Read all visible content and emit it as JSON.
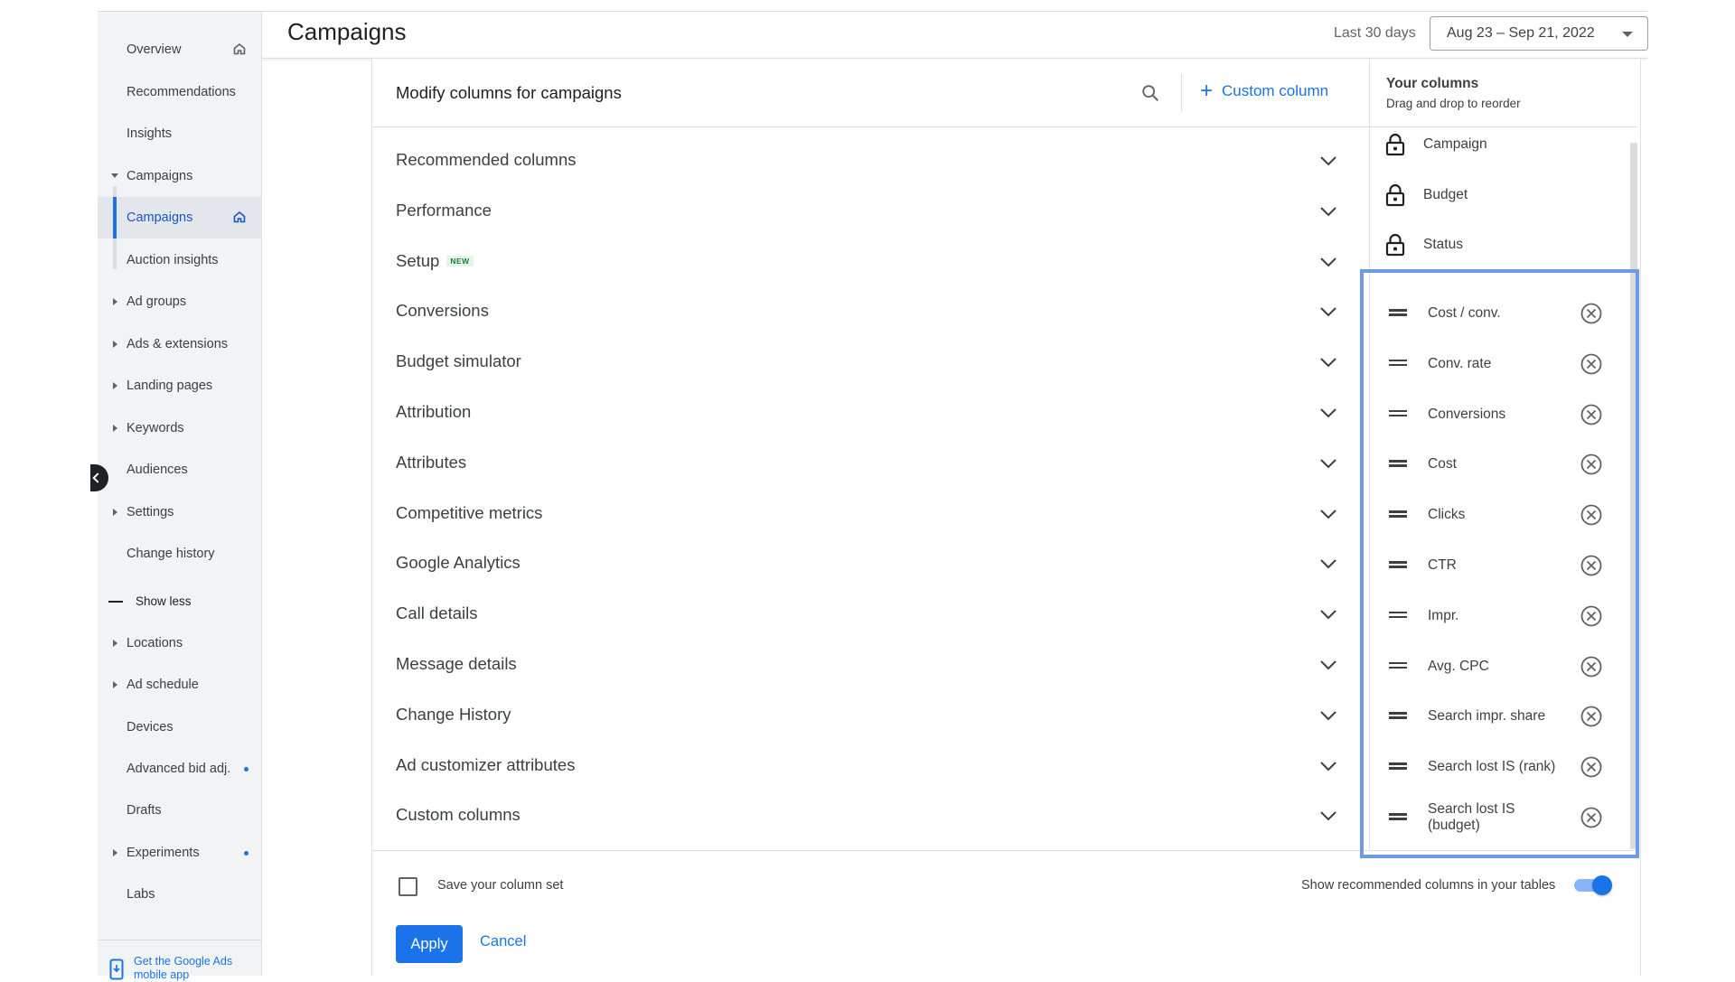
{
  "sidebar": {
    "items": [
      {
        "label": "Overview",
        "arrow": "none",
        "home": true,
        "dot": false
      },
      {
        "label": "Recommendations",
        "arrow": "none",
        "home": false,
        "dot": false
      },
      {
        "label": "Insights",
        "arrow": "none",
        "home": false,
        "dot": false
      },
      {
        "label": "Campaigns",
        "arrow": "down",
        "home": false,
        "dot": false
      },
      {
        "label": "Campaigns",
        "arrow": "none",
        "home": true,
        "dot": false,
        "active": true
      },
      {
        "label": "Auction insights",
        "arrow": "none",
        "home": false,
        "dot": false
      },
      {
        "label": "Ad groups",
        "arrow": "right",
        "home": false,
        "dot": false
      },
      {
        "label": "Ads & extensions",
        "arrow": "right",
        "home": false,
        "dot": false
      },
      {
        "label": "Landing pages",
        "arrow": "right",
        "home": false,
        "dot": false
      },
      {
        "label": "Keywords",
        "arrow": "right",
        "home": false,
        "dot": false
      },
      {
        "label": "Audiences",
        "arrow": "none",
        "home": false,
        "dot": false
      },
      {
        "label": "Settings",
        "arrow": "right",
        "home": false,
        "dot": false
      },
      {
        "label": "Change history",
        "arrow": "none",
        "home": false,
        "dot": false
      }
    ],
    "show_less": "Show less",
    "more_items": [
      {
        "label": "Locations",
        "arrow": "right",
        "dot": false
      },
      {
        "label": "Ad schedule",
        "arrow": "right",
        "dot": false
      },
      {
        "label": "Devices",
        "arrow": "none",
        "dot": false
      },
      {
        "label": "Advanced bid adj.",
        "arrow": "none",
        "dot": true
      },
      {
        "label": "Drafts",
        "arrow": "none",
        "dot": false
      },
      {
        "label": "Experiments",
        "arrow": "right",
        "dot": true
      },
      {
        "label": "Labs",
        "arrow": "none",
        "dot": false
      }
    ],
    "footer_text": "Get the Google Ads mobile app"
  },
  "header": {
    "title": "Campaigns",
    "range_label": "Last 30 days",
    "date_range": "Aug 23 – Sep 21, 2022"
  },
  "dialog": {
    "title": "Modify columns for campaigns",
    "custom_column_label": "Custom column",
    "categories": [
      {
        "label": "Recommended columns",
        "badge": ""
      },
      {
        "label": "Performance",
        "badge": ""
      },
      {
        "label": "Setup",
        "badge": "NEW"
      },
      {
        "label": "Conversions",
        "badge": ""
      },
      {
        "label": "Budget simulator",
        "badge": ""
      },
      {
        "label": "Attribution",
        "badge": ""
      },
      {
        "label": "Attributes",
        "badge": ""
      },
      {
        "label": "Competitive metrics",
        "badge": ""
      },
      {
        "label": "Google Analytics",
        "badge": ""
      },
      {
        "label": "Call details",
        "badge": ""
      },
      {
        "label": "Message details",
        "badge": ""
      },
      {
        "label": "Change History",
        "badge": ""
      },
      {
        "label": "Ad customizer attributes",
        "badge": ""
      },
      {
        "label": "Custom columns",
        "badge": ""
      }
    ],
    "save_label": "Save your column set",
    "save_checked": false,
    "show_recommended_label": "Show recommended columns in your tables",
    "show_recommended_on": true,
    "apply_label": "Apply",
    "cancel_label": "Cancel"
  },
  "your_columns": {
    "title": "Your columns",
    "subtitle": "Drag and drop to reorder",
    "locked": [
      "Campaign",
      "Budget",
      "Status"
    ],
    "columns": [
      "Cost / conv.",
      "Conv. rate",
      "Conversions",
      "Cost",
      "Clicks",
      "CTR",
      "Impr.",
      "Avg. CPC",
      "Search impr. share",
      "Search lost IS (rank)",
      "Search lost IS (budget)"
    ]
  },
  "colors": {
    "accent": "#1a73e8",
    "highlight": "#6f9ae8",
    "badge_green": "#188038"
  }
}
